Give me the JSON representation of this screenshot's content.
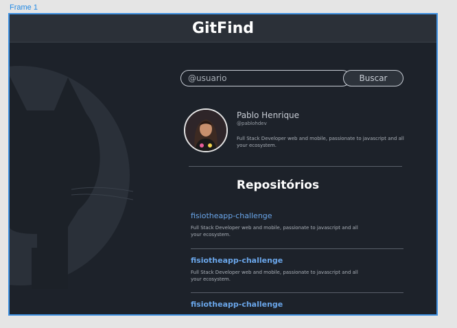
{
  "frame": {
    "label": "Frame 1"
  },
  "header": {
    "title": "GitFind"
  },
  "search": {
    "placeholder": "@usuario",
    "button_label": "Buscar"
  },
  "profile": {
    "name": "Pablo Henrique",
    "handle": "@pablohdev",
    "bio": "Full Stack Developer web and mobile, passionate to javascript and all your ecosystem."
  },
  "repositories": {
    "title": "Repositórios",
    "items": [
      {
        "name": "fisiotheapp-challenge",
        "description": "Full Stack Developer web and mobile, passionate to javascript and all your ecosystem."
      },
      {
        "name": "fisiotheapp-challenge",
        "description": "Full Stack Developer web and mobile, passionate to javascript and all your ecosystem."
      },
      {
        "name": "fisiotheapp-challenge",
        "description": ""
      }
    ]
  },
  "colors": {
    "background": "#1d222a",
    "header": "#2b3038",
    "link": "#6aa6ea",
    "frame_border": "#3d8fe0"
  }
}
